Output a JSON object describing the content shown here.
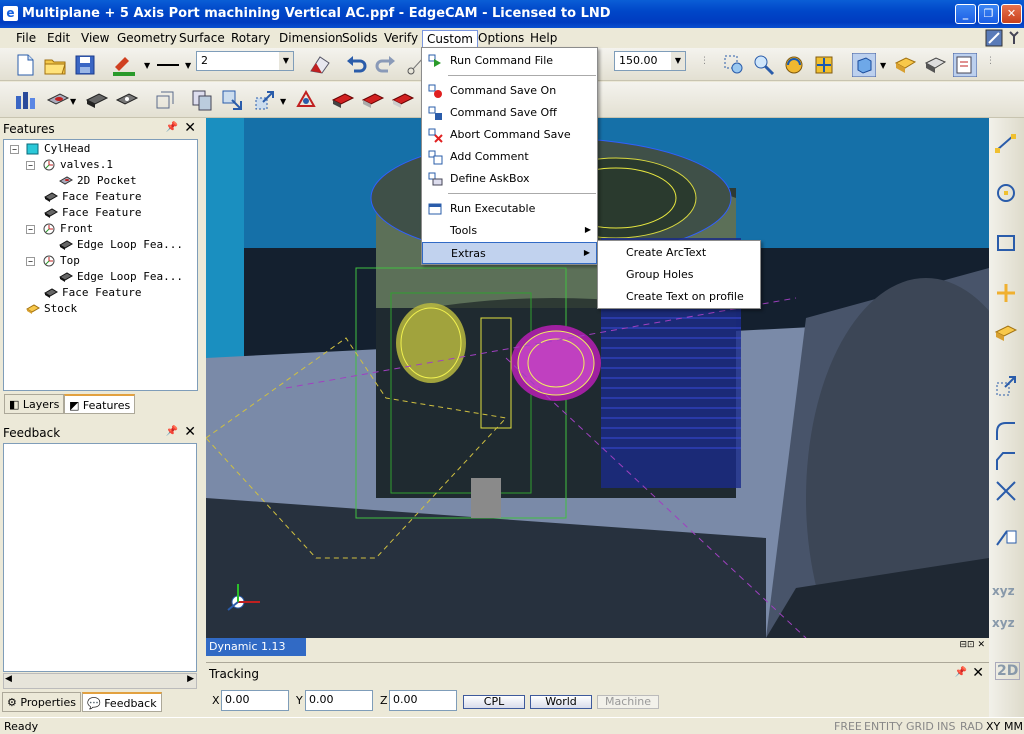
{
  "window": {
    "title": "Multiplane + 5 Axis Port machining Vertical AC.ppf - EdgeCAM - Licensed to LND",
    "app_icon": "e"
  },
  "menubar": {
    "items": [
      "File",
      "Edit",
      "View",
      "Geometry",
      "Surface",
      "Rotary",
      "Dimension",
      "Solids",
      "Verify",
      "Custom",
      "Options",
      "Help"
    ]
  },
  "toolbar": {
    "line_width_value": "2",
    "zoom_value": "150.00"
  },
  "features_panel": {
    "title": "Features",
    "tree": [
      {
        "label": "CylHead",
        "icon": "cube-icon",
        "expander": "−"
      },
      {
        "label": "valves.1",
        "icon": "cpl-icon",
        "expander": "−"
      },
      {
        "label": "2D Pocket",
        "icon": "pocket-icon"
      },
      {
        "label": "Face Feature",
        "icon": "face-icon"
      },
      {
        "label": "Face Feature",
        "icon": "face-icon"
      },
      {
        "label": "Front",
        "icon": "cpl-icon",
        "expander": "−"
      },
      {
        "label": "Edge Loop Fea...",
        "icon": "face-icon"
      },
      {
        "label": "Top",
        "icon": "cpl-icon",
        "expander": "−"
      },
      {
        "label": "Edge Loop Fea...",
        "icon": "face-icon"
      },
      {
        "label": "Face Feature",
        "icon": "face-icon"
      },
      {
        "label": "Stock",
        "icon": "stock-icon"
      }
    ],
    "tabs": [
      "Layers",
      "Features"
    ]
  },
  "feedback_panel": {
    "title": "Feedback",
    "tabs": [
      "Properties",
      "Feedback"
    ]
  },
  "viewport": {
    "mode_label": "Dynamic 1.13"
  },
  "tracking": {
    "title": "Tracking",
    "x_label": "X",
    "y_label": "Y",
    "z_label": "Z",
    "x": "0.00",
    "y": "0.00",
    "z": "0.00",
    "buttons": [
      "CPL",
      "World",
      "Machine"
    ]
  },
  "custom_menu": {
    "items": [
      {
        "label": "Run Command File",
        "icon": "run-cmd-icon"
      },
      {
        "label": "Command Save On",
        "icon": "record-on-icon"
      },
      {
        "label": "Command Save Off",
        "icon": "record-off-icon"
      },
      {
        "label": "Abort Command Save",
        "icon": "abort-icon"
      },
      {
        "label": "Add Comment",
        "icon": "comment-icon"
      },
      {
        "label": "Define AskBox",
        "icon": "askbox-icon"
      },
      {
        "label": "Run Executable",
        "icon": "exe-icon"
      },
      {
        "label": "Tools",
        "icon": ""
      },
      {
        "label": "Extras",
        "icon": ""
      }
    ]
  },
  "extras_submenu": {
    "items": [
      "Create ArcText",
      "Group Holes",
      "Create Text on profile"
    ]
  },
  "statusbar": {
    "ready": "Ready",
    "flags": [
      "FREE",
      "ENTITY",
      "GRID",
      "INS",
      "RAD",
      "XY",
      "MM"
    ]
  },
  "colors": {
    "titlebar": "#0046c8",
    "selection": "#316ac5",
    "viewport_bg": "#1a2640",
    "cyan_bg": "#1a8fc0"
  }
}
